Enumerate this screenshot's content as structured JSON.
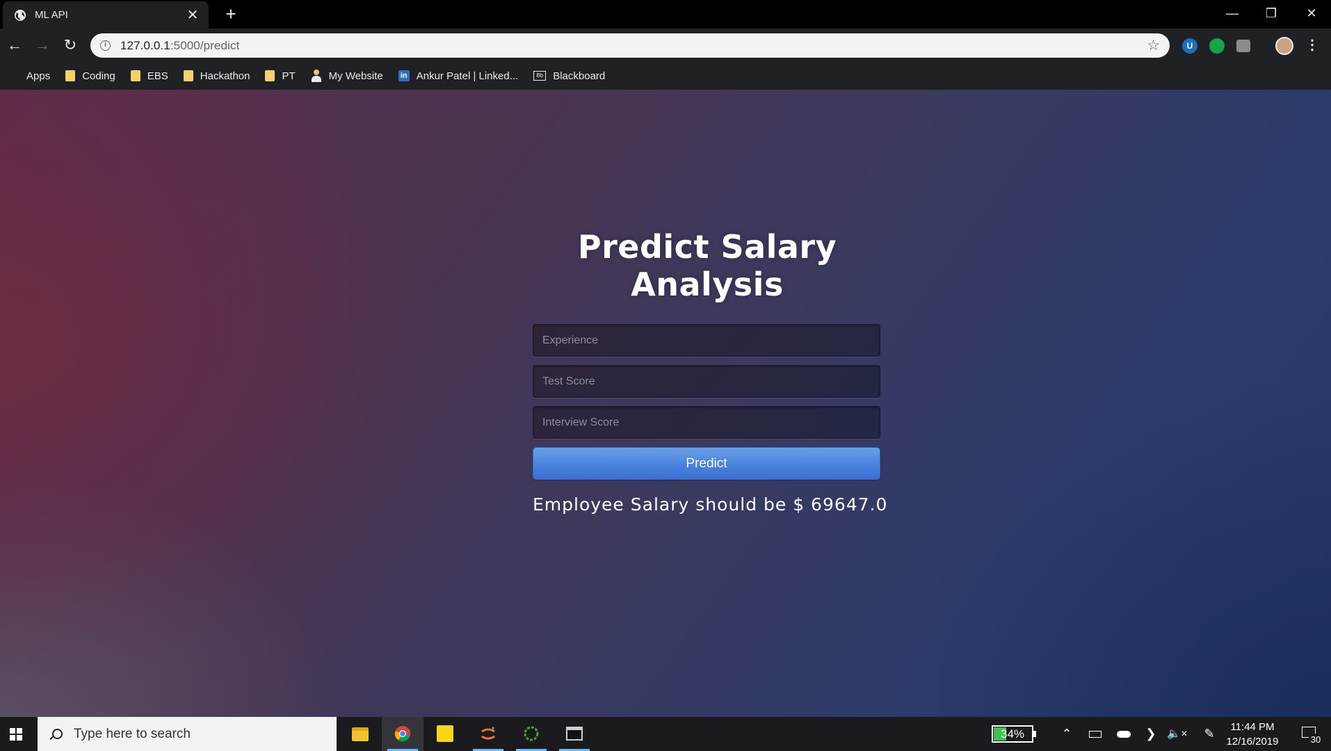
{
  "browser": {
    "tab_title": "ML API",
    "tab_close": "✕",
    "new_tab": "+",
    "url_host": "127.0.0.1",
    "url_path": ":5000/predict",
    "window_controls": {
      "minimize": "—",
      "restore": "❐",
      "close": "✕"
    }
  },
  "bookmarks": [
    {
      "label": "Apps",
      "icon": "apps-grid-icon"
    },
    {
      "label": "Coding",
      "icon": "folder-icon"
    },
    {
      "label": "EBS",
      "icon": "folder-icon"
    },
    {
      "label": "Hackathon",
      "icon": "folder-icon"
    },
    {
      "label": "PT",
      "icon": "folder-icon"
    },
    {
      "label": "My Website",
      "icon": "person-icon"
    },
    {
      "label": "Ankur Patel | Linked...",
      "icon": "linkedin-icon"
    },
    {
      "label": "Blackboard",
      "icon": "blackboard-icon"
    }
  ],
  "page": {
    "title": "Predict Salary Analysis",
    "fields": [
      {
        "placeholder": "Experience",
        "value": ""
      },
      {
        "placeholder": "Test Score",
        "value": ""
      },
      {
        "placeholder": "Interview Score",
        "value": ""
      }
    ],
    "predict_label": "Predict",
    "result_text": "Employee Salary should be $ 69647.0"
  },
  "taskbar": {
    "search_placeholder": "Type here to search",
    "battery": "34%",
    "time": "11:44 PM",
    "date": "12/16/2019",
    "notifications": "30",
    "apps": [
      "file-explorer-icon",
      "chrome-icon",
      "sticky-notes-icon",
      "jupyter-icon",
      "anaconda-icon",
      "terminal-icon"
    ]
  },
  "colors": {
    "predict_button": "#4a82dd",
    "background_left": "#5d2d48",
    "background_right": "#233669",
    "battery_fill": "#3ec24e"
  }
}
